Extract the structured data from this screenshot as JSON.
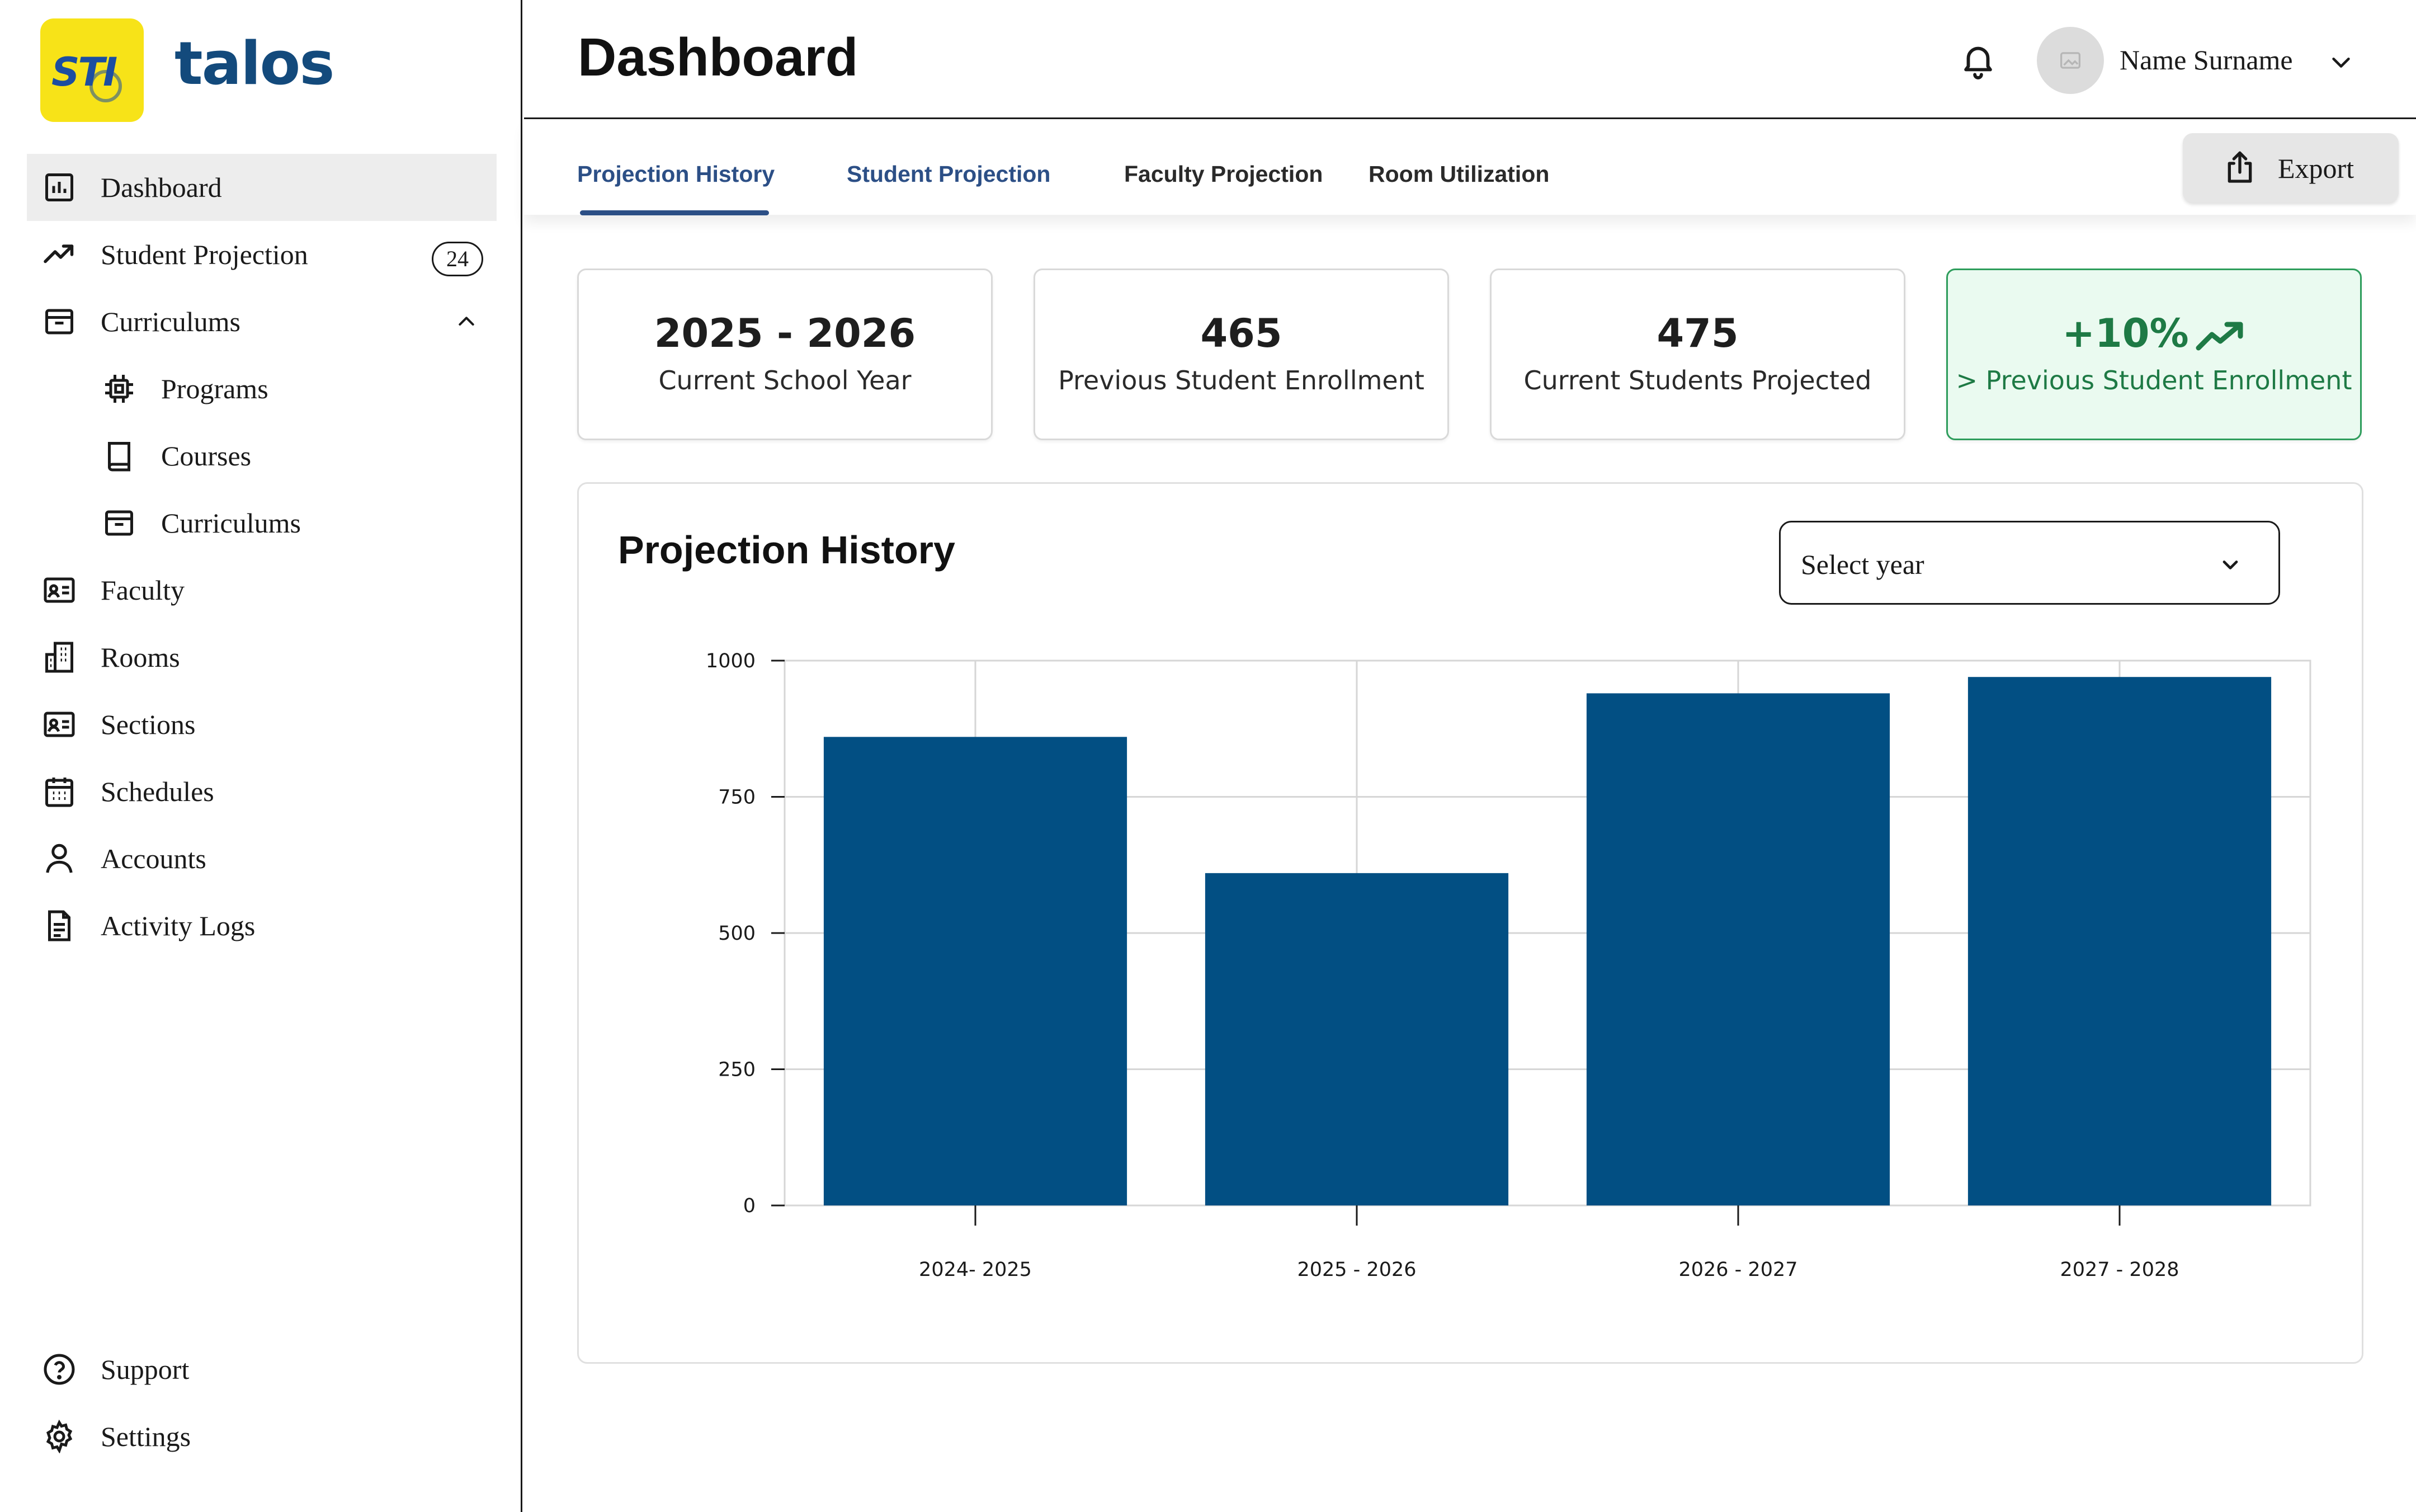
{
  "brand": {
    "logo_text": "STI",
    "name": "talos"
  },
  "sidebar": {
    "items": [
      {
        "label": "Dashboard",
        "icon": "bar-chart-icon",
        "active": true
      },
      {
        "label": "Student Projection",
        "icon": "trending-up-icon",
        "badge": "24"
      },
      {
        "label": "Curriculums",
        "icon": "archive-icon",
        "expanded": true
      },
      {
        "label": "Programs",
        "icon": "chip-icon"
      },
      {
        "label": "Courses",
        "icon": "book-icon"
      },
      {
        "label": "Curriculums",
        "icon": "archive-icon"
      },
      {
        "label": "Faculty",
        "icon": "id-card-icon"
      },
      {
        "label": "Rooms",
        "icon": "building-icon"
      },
      {
        "label": "Sections",
        "icon": "id-card-icon"
      },
      {
        "label": "Schedules",
        "icon": "calendar-icon"
      },
      {
        "label": "Accounts",
        "icon": "user-icon"
      },
      {
        "label": "Activity Logs",
        "icon": "document-icon"
      }
    ],
    "bottom": [
      {
        "label": "Support",
        "icon": "help-circle-icon"
      },
      {
        "label": "Settings",
        "icon": "gear-icon"
      }
    ]
  },
  "header": {
    "title": "Dashboard",
    "user_name": "Name Surname"
  },
  "tabs": [
    {
      "label": "Projection History",
      "active": true
    },
    {
      "label": "Student Projection"
    },
    {
      "label": "Faculty Projection"
    },
    {
      "label": "Room Utilization"
    }
  ],
  "export_label": "Export",
  "stats": [
    {
      "value": "2025 - 2026",
      "label": "Current School Year"
    },
    {
      "value": "465",
      "label": "Previous Student Enrollment"
    },
    {
      "value": "475",
      "label": "Current Students Projected"
    },
    {
      "value": "+10%",
      "label": "> Previous Student Enrollment",
      "highlight": true
    }
  ],
  "chart_panel": {
    "title": "Projection History",
    "select_placeholder": "Select year"
  },
  "colors": {
    "bar": "#024f83",
    "accent_blue": "#2c4f86",
    "positive_green": "#1e7a45",
    "logo_yellow": "#f7e318"
  },
  "chart_data": {
    "type": "bar",
    "categories": [
      "2024- 2025",
      "2025 - 2026",
      "2026 - 2027",
      "2027 - 2028"
    ],
    "values": [
      860,
      610,
      940,
      970
    ],
    "ylim": [
      0,
      1000
    ],
    "yticks": [
      0,
      250,
      500,
      750,
      1000
    ],
    "grid": true,
    "title": "",
    "xlabel": "",
    "ylabel": ""
  }
}
